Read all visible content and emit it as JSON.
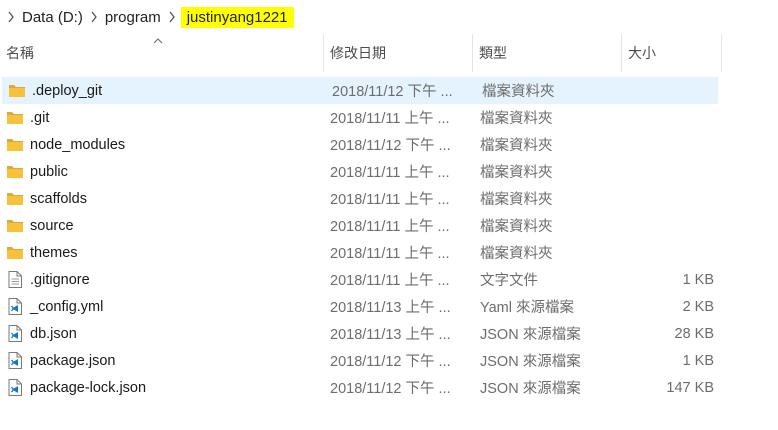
{
  "breadcrumb": {
    "items": [
      {
        "label": "Data (D:)"
      },
      {
        "label": "program"
      },
      {
        "label": "justinyang1221"
      }
    ]
  },
  "columns": {
    "name": "名稱",
    "date": "修改日期",
    "type": "類型",
    "size": "大小"
  },
  "files": [
    {
      "name": ".deploy_git",
      "date": "2018/11/12 下午 ...",
      "type": "檔案資料夾",
      "size": "",
      "icon": "folder-icon",
      "selected": true
    },
    {
      "name": ".git",
      "date": "2018/11/11 上午 ...",
      "type": "檔案資料夾",
      "size": "",
      "icon": "folder-icon"
    },
    {
      "name": "node_modules",
      "date": "2018/11/12 下午 ...",
      "type": "檔案資料夾",
      "size": "",
      "icon": "folder-icon"
    },
    {
      "name": "public",
      "date": "2018/11/11 上午 ...",
      "type": "檔案資料夾",
      "size": "",
      "icon": "folder-icon"
    },
    {
      "name": "scaffolds",
      "date": "2018/11/11 上午 ...",
      "type": "檔案資料夾",
      "size": "",
      "icon": "folder-icon"
    },
    {
      "name": "source",
      "date": "2018/11/11 上午 ...",
      "type": "檔案資料夾",
      "size": "",
      "icon": "folder-icon"
    },
    {
      "name": "themes",
      "date": "2018/11/11 上午 ...",
      "type": "檔案資料夾",
      "size": "",
      "icon": "folder-icon"
    },
    {
      "name": ".gitignore",
      "date": "2018/11/11 上午 ...",
      "type": "文字文件",
      "size": "1 KB",
      "icon": "text-file-icon"
    },
    {
      "name": "_config.yml",
      "date": "2018/11/13 上午 ...",
      "type": "Yaml 來源檔案",
      "size": "2 KB",
      "icon": "vscode-file-icon"
    },
    {
      "name": "db.json",
      "date": "2018/11/13 上午 ...",
      "type": "JSON 來源檔案",
      "size": "28 KB",
      "icon": "vscode-file-icon"
    },
    {
      "name": "package.json",
      "date": "2018/11/12 下午 ...",
      "type": "JSON 來源檔案",
      "size": "1 KB",
      "icon": "vscode-file-icon"
    },
    {
      "name": "package-lock.json",
      "date": "2018/11/12 下午 ...",
      "type": "JSON 來源檔案",
      "size": "147 KB",
      "icon": "vscode-file-icon"
    }
  ],
  "colors": {
    "highlight": "#ffff00",
    "selection": "#e5f3ff",
    "folder": "#f8c13b"
  }
}
